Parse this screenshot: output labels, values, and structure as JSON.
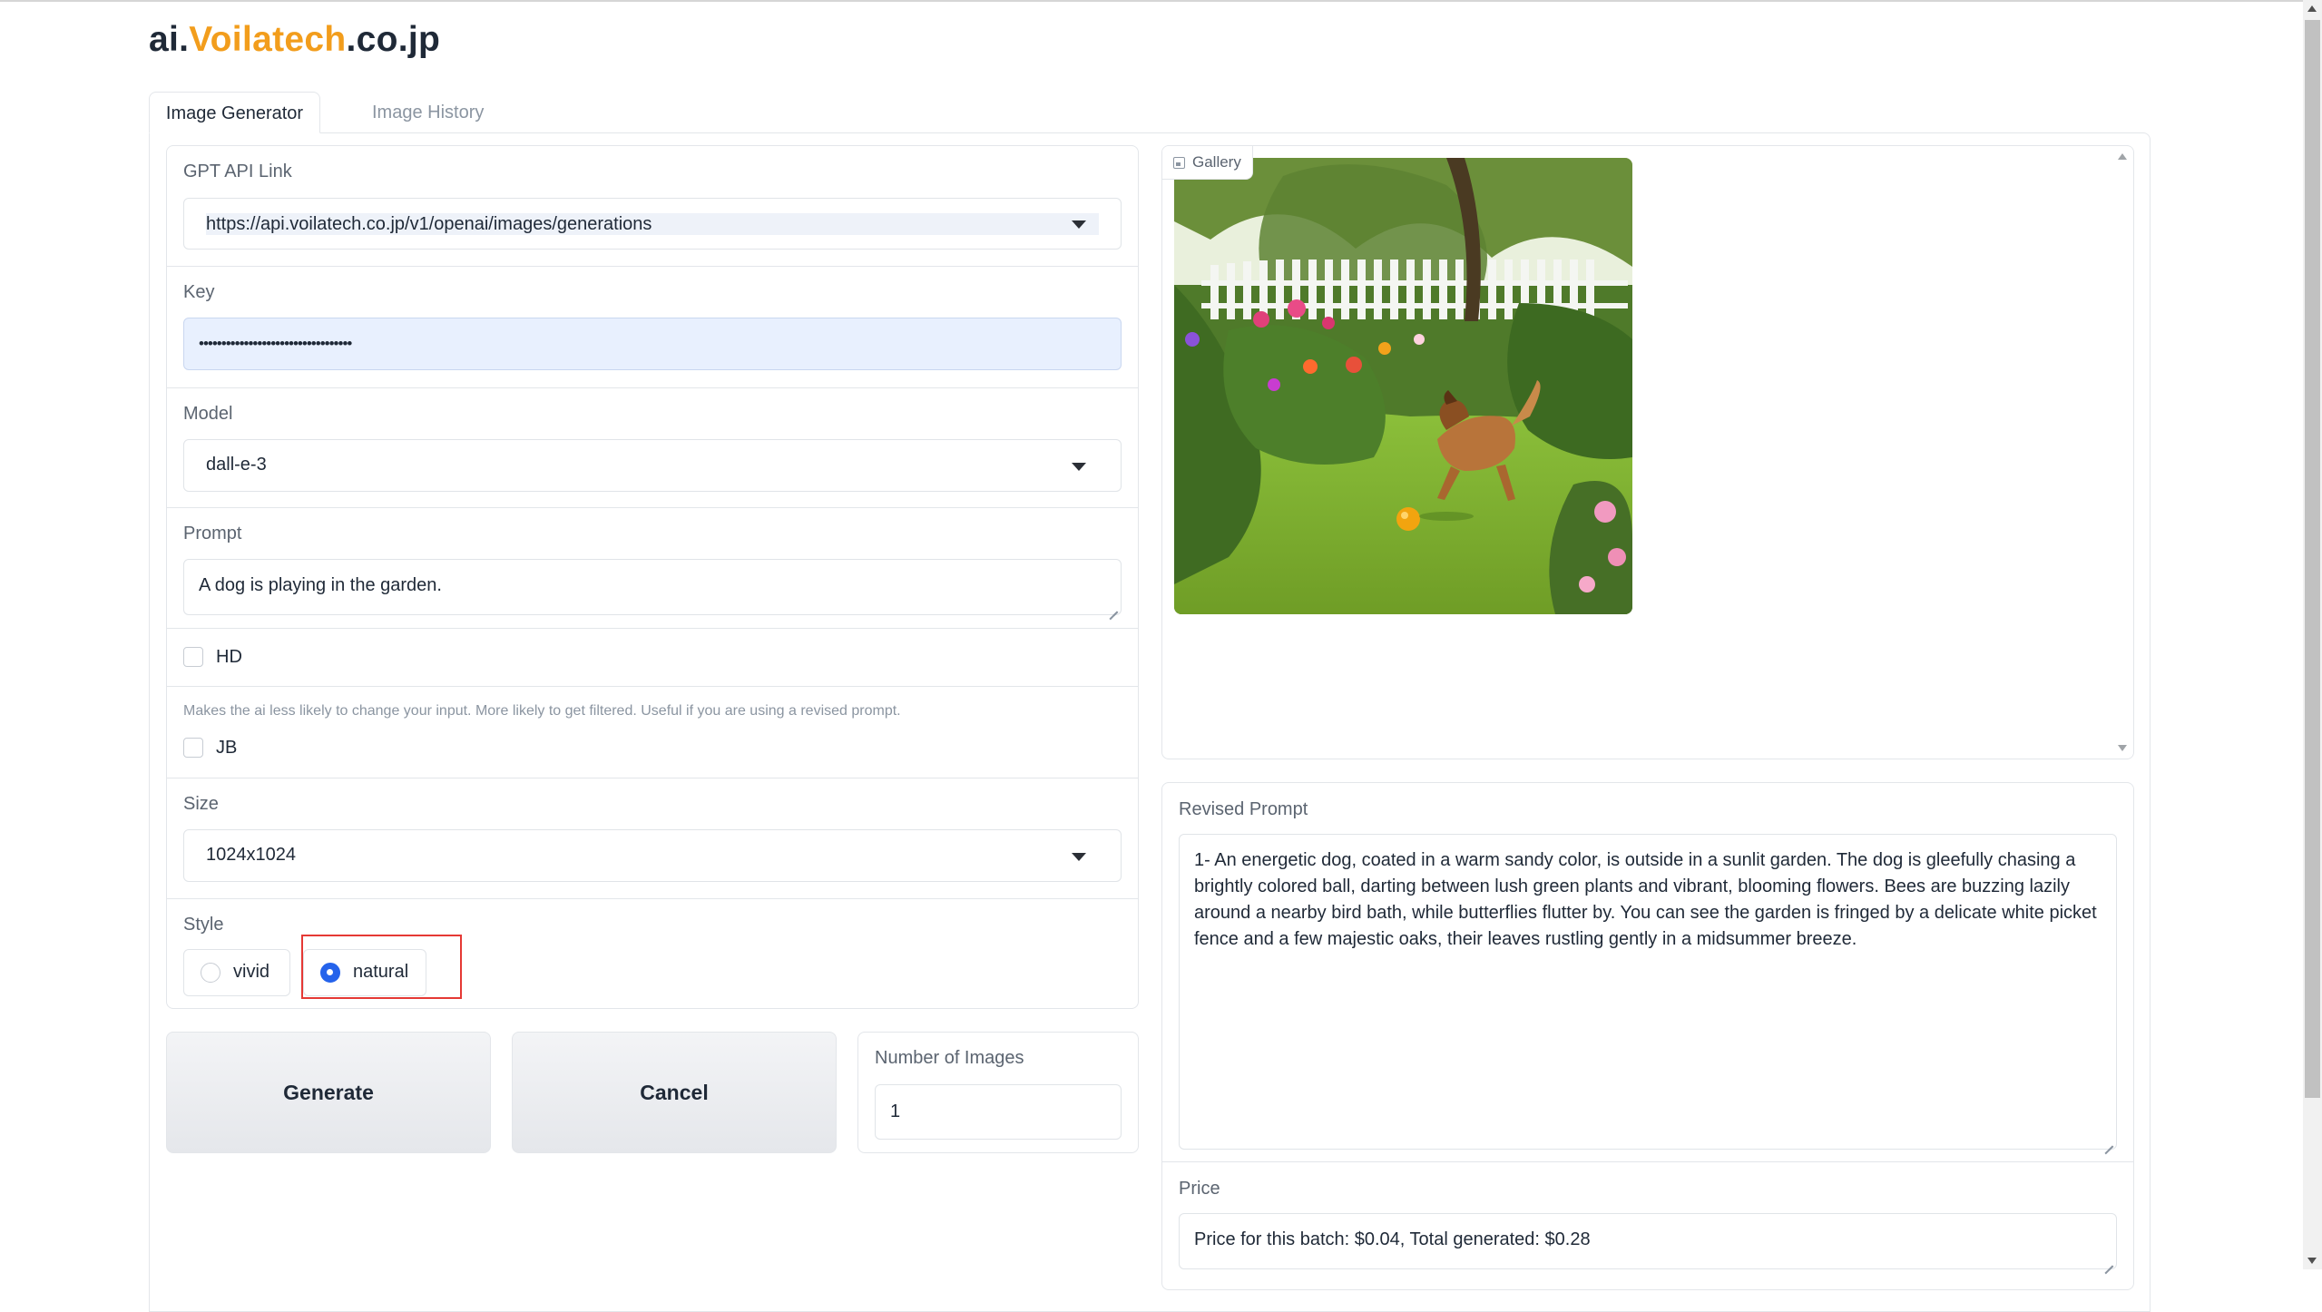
{
  "logo": {
    "prefix": "ai.",
    "accent": "Voilatech",
    "suffix": ".co.jp"
  },
  "colors": {
    "accent": "#f29d1c",
    "primary": "#2563eb",
    "highlight": "#e53935"
  },
  "tabs": [
    {
      "label": "Image Generator",
      "active": true
    },
    {
      "label": "Image History",
      "active": false
    }
  ],
  "form": {
    "api_link": {
      "label": "GPT API Link",
      "value": "https://api.voilatech.co.jp/v1/openai/images/generations"
    },
    "key": {
      "label": "Key",
      "value": "••••••••••••••••••••••••••••••••••"
    },
    "model": {
      "label": "Model",
      "value": "dall-e-3"
    },
    "prompt": {
      "label": "Prompt",
      "value": "A dog is playing in the garden."
    },
    "hd": {
      "label": "HD",
      "checked": false
    },
    "jb": {
      "hint": "Makes the ai less likely to change your input. More likely to get filtered. Useful if you are using a revised prompt.",
      "label": "JB",
      "checked": false
    },
    "size": {
      "label": "Size",
      "value": "1024x1024"
    },
    "style": {
      "label": "Style",
      "options": [
        "vivid",
        "natural"
      ],
      "selected": "natural"
    }
  },
  "actions": {
    "generate": "Generate",
    "cancel": "Cancel"
  },
  "num_images": {
    "label": "Number of Images",
    "value": "1"
  },
  "gallery": {
    "label": "Gallery",
    "icon": "image-icon"
  },
  "revised_prompt": {
    "label": "Revised Prompt",
    "lines": [
      "1- An energetic dog, coated in a warm sandy color, is outside in a sunlit garden. The dog is gleefully chasing a",
      "brightly colored ball, darting between lush green plants and vibrant, blooming flowers. Bees are buzzing lazily",
      "around a nearby bird bath, while butterflies flutter by. You can see the garden is fringed by a delicate white picket",
      "fence and a few majestic oaks, their leaves rustling gently in a midsummer breeze."
    ]
  },
  "price": {
    "label": "Price",
    "value": "Price for this batch: $0.04, Total generated: $0.28"
  }
}
